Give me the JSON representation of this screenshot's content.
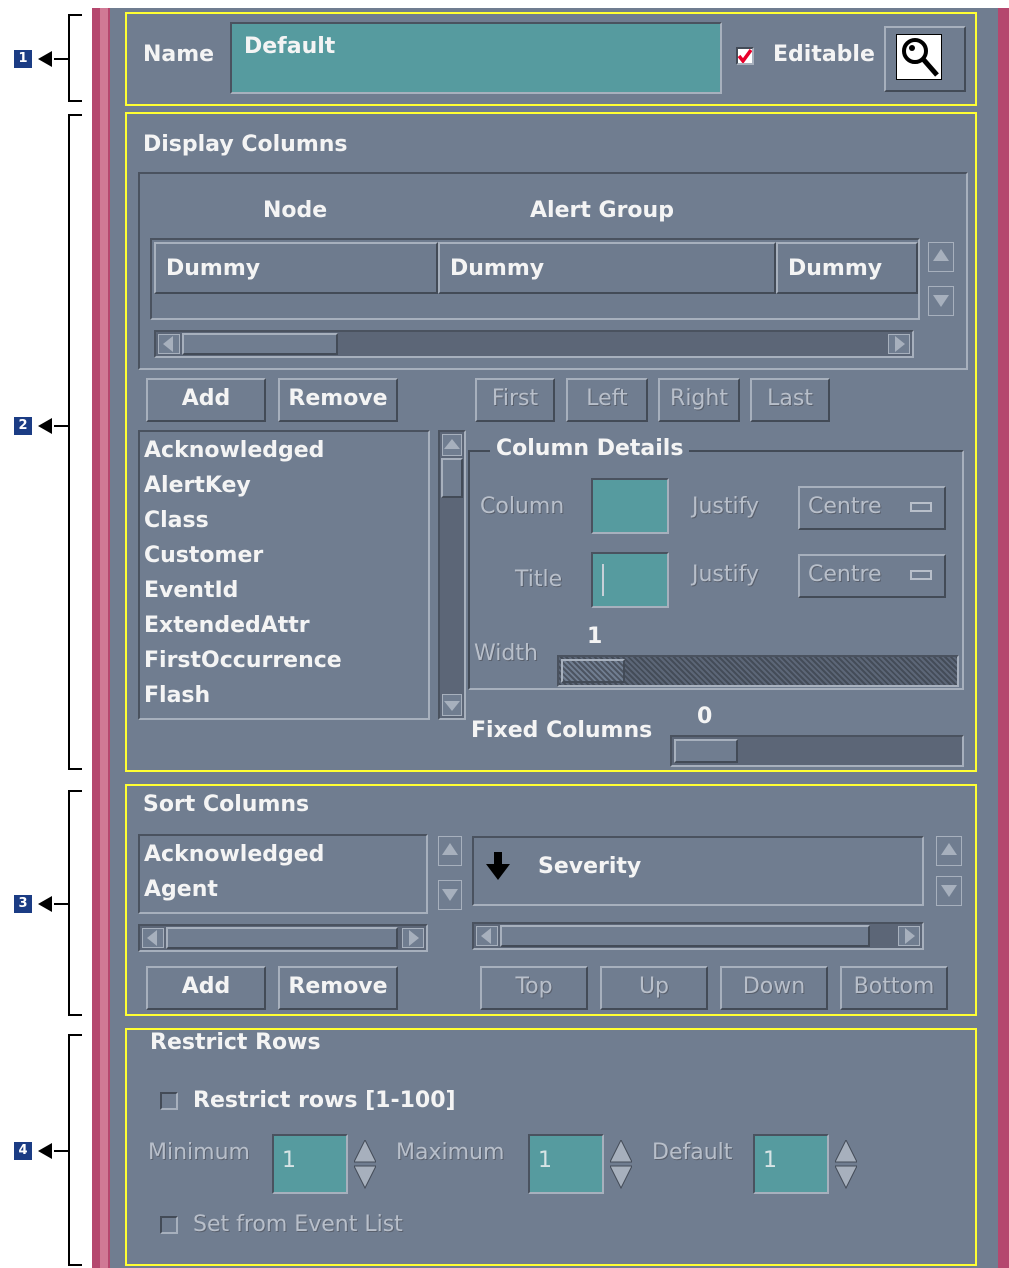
{
  "callouts": [
    "1",
    "2",
    "3",
    "4"
  ],
  "colors": {
    "panel": "#707d90",
    "field": "#569b9f",
    "highlight": "#ffff33",
    "frame": "#b5476e",
    "checkmark": "#e8002a"
  },
  "name_row": {
    "label": "Name",
    "value": "Default",
    "editable_label": "Editable",
    "editable_checked": true,
    "search_icon": "magnifier-icon"
  },
  "display_columns": {
    "title": "Display Columns",
    "headers": [
      "Node",
      "Alert Group"
    ],
    "cells": [
      "Dummy",
      "Dummy",
      "Dummy"
    ],
    "buttons": {
      "add": "Add",
      "remove": "Remove",
      "first": "First",
      "left": "Left",
      "right": "Right",
      "last": "Last"
    },
    "field_list": [
      "Acknowledged",
      "AlertKey",
      "Class",
      "Customer",
      "EventId",
      "ExtendedAttr",
      "FirstOccurrence",
      "Flash"
    ],
    "details": {
      "title": "Column Details",
      "column_label": "Column",
      "title_label": "Title",
      "justify_label": "Justify",
      "justify_value": "Centre",
      "width_label": "Width",
      "width_value": "1"
    },
    "fixed_columns_label": "Fixed Columns",
    "fixed_columns_value": "0"
  },
  "sort_columns": {
    "title": "Sort Columns",
    "field_list": [
      "Acknowledged",
      "Agent"
    ],
    "sorted": [
      "Severity"
    ],
    "sort_icon": "arrow-down-icon",
    "buttons": {
      "add": "Add",
      "remove": "Remove",
      "top": "Top",
      "up": "Up",
      "down": "Down",
      "bottom": "Bottom"
    }
  },
  "restrict_rows": {
    "title": "Restrict Rows",
    "checkbox_label": "Restrict rows [1-100]",
    "checked": false,
    "minimum_label": "Minimum",
    "minimum_value": "1",
    "maximum_label": "Maximum",
    "maximum_value": "1",
    "default_label": "Default",
    "default_value": "1",
    "set_from_label": "Set from Event List"
  }
}
